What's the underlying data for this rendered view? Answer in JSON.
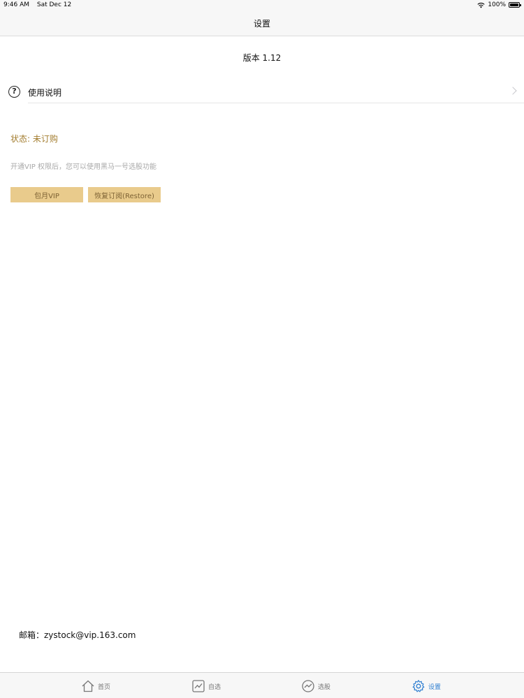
{
  "status_bar": {
    "time": "9:46 AM",
    "date": "Sat Dec 12",
    "battery": "100%"
  },
  "nav": {
    "title": "设置"
  },
  "version": "版本 1.12",
  "help": {
    "label": "使用说明"
  },
  "subscription": {
    "status": "状态: 未订购",
    "description": "开通VIP 权限后，您可以使用黑马一号选股功能",
    "vip_button": "包月VIP",
    "restore_button": "恢复订阅(Restore)"
  },
  "contact": {
    "email": "邮箱：zystock@vip.163.com"
  },
  "tabs": [
    {
      "label": "首页",
      "icon": "home-icon"
    },
    {
      "label": "自选",
      "icon": "chart-icon"
    },
    {
      "label": "选股",
      "icon": "trend-icon"
    },
    {
      "label": "设置",
      "icon": "gear-icon"
    }
  ],
  "colors": {
    "accent": "#e9cb8c",
    "status_text": "#a37d2f",
    "tab_active": "#2f7fd1"
  }
}
